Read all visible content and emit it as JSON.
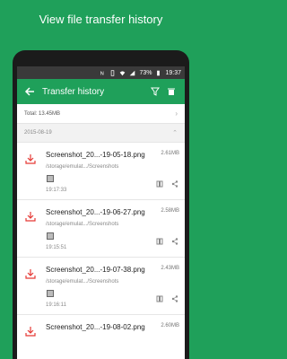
{
  "promo": {
    "title": "View file transfer history"
  },
  "status_bar": {
    "battery_percent": "73%",
    "time": "19:37"
  },
  "app_bar": {
    "back_icon": "arrow-back-icon",
    "title": "Transfer history",
    "filter_icon": "filter-icon",
    "delete_icon": "trash-icon"
  },
  "summary": {
    "total": "Total: 13.45MB"
  },
  "date_group": {
    "date": "2015-08-19"
  },
  "items": [
    {
      "name": "Screenshot_20...-19-05-18.png",
      "size": "2.61MB",
      "path": "/storage/emulat.../Screenshots",
      "time": "19:17:33"
    },
    {
      "name": "Screenshot_20...-19-06-27.png",
      "size": "2.58MB",
      "path": "/storage/emulat.../Screenshots",
      "time": "19:15:51"
    },
    {
      "name": "Screenshot_20...-19-07-38.png",
      "size": "2.43MB",
      "path": "/storage/emulat.../Screenshots",
      "time": "19:16:11"
    },
    {
      "name": "Screenshot_20...-19-08-02.png",
      "size": "2.60MB",
      "path": "",
      "time": ""
    }
  ],
  "colors": {
    "brand": "#1fa05a",
    "accent_red": "#e53935"
  }
}
